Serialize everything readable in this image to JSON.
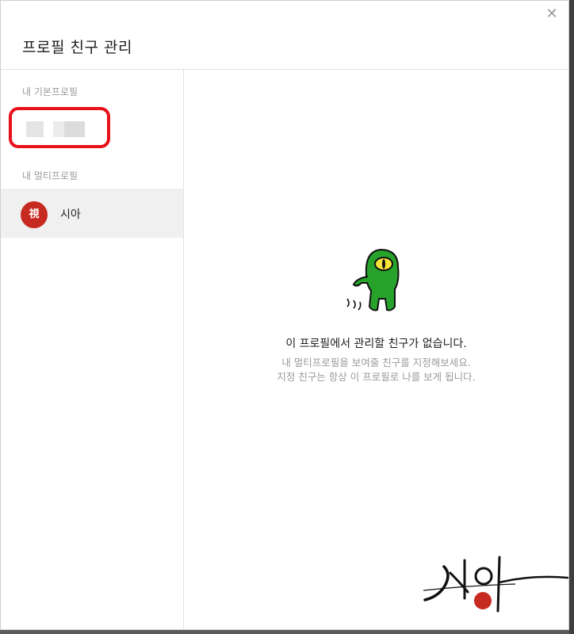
{
  "dialog": {
    "title": "프로필 친구 관리",
    "close_icon": "close-icon",
    "close_glyph": "✕"
  },
  "sidebar": {
    "basic_section_label": "내 기본프로필",
    "multi_section_label": "내 멀티프로필",
    "multi_profiles": [
      {
        "name": "시아",
        "avatar_text": "視"
      }
    ]
  },
  "empty_state": {
    "title": "이 프로필에서 관리할 친구가 없습니다.",
    "description_line1": "내 멀티프로필을 보여줄 친구를 지정해보세요.",
    "description_line2": "지정 친구는 항상 이 프로필로 나를 보게 됩니다.",
    "illustration": "green-character-icon"
  },
  "watermark": {
    "text": "시아",
    "seal_icon": "seal-icon"
  },
  "colors": {
    "highlight_border": "#e8101a",
    "avatar_bg": "#c72a20",
    "character_green": "#27a22b",
    "character_eye": "#f6e43a"
  }
}
